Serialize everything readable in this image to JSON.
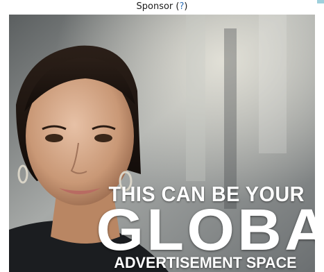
{
  "sponsor": {
    "label": "Sponsor",
    "open_paren": " (",
    "help_link": "?",
    "close_paren": ")"
  },
  "ad": {
    "line1": "THIS CAN BE YOUR",
    "line2": "GLOBAL",
    "line3": "ADVERTISEMENT SPACE"
  },
  "colors": {
    "link": "#2f6fb6",
    "ad_text": "#ffffff",
    "corner_accent": "#9fd0dc"
  }
}
